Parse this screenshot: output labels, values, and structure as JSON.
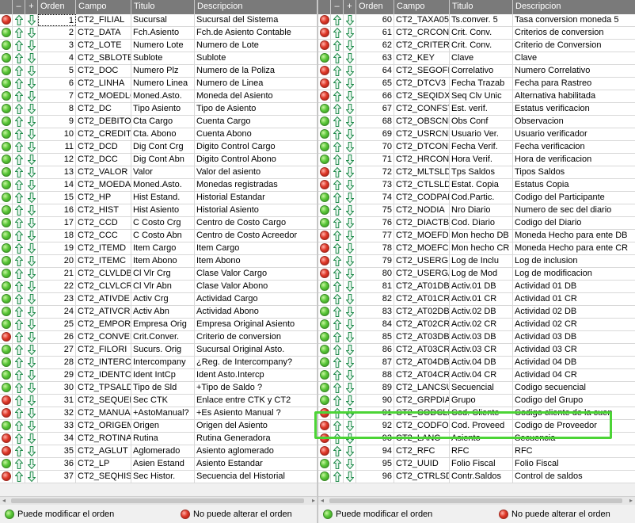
{
  "columns": {
    "dash": "–",
    "plus": "+",
    "orden": "Orden",
    "campo": "Campo",
    "titulo": "Titulo",
    "descripcion": "Descripcion"
  },
  "colors": {
    "header_bg": "#7a7a7a",
    "green": "#4cb82e",
    "red": "#d63322",
    "arrow": "#1f8a4a",
    "highlight": "#4cd436"
  },
  "legend": {
    "can_modify": "Puede modificar el orden",
    "cannot_modify": "No puede alterar el orden"
  },
  "left_rows": [
    {
      "status": "red",
      "orden": "1",
      "campo": "CT2_FILIAL",
      "titulo": "Sucursal",
      "descripcion": "Sucursal del Sistema"
    },
    {
      "status": "green",
      "orden": "2",
      "campo": "CT2_DATA",
      "titulo": "Fch.Asiento",
      "descripcion": "Fch.de Asiento Contable"
    },
    {
      "status": "green",
      "orden": "3",
      "campo": "CT2_LOTE",
      "titulo": "Numero Lote",
      "descripcion": "Numero de Lote"
    },
    {
      "status": "green",
      "orden": "4",
      "campo": "CT2_SBLOTE",
      "titulo": "Sublote",
      "descripcion": "Sublote"
    },
    {
      "status": "green",
      "orden": "5",
      "campo": "CT2_DOC",
      "titulo": "Numero Plz",
      "descripcion": "Numero de la Poliza"
    },
    {
      "status": "green",
      "orden": "6",
      "campo": "CT2_LINHA",
      "titulo": "Numero Linea",
      "descripcion": "Numero de Linea"
    },
    {
      "status": "green",
      "orden": "7",
      "campo": "CT2_MOEDLC",
      "titulo": "Moned.Asto.",
      "descripcion": "Moneda del Asiento"
    },
    {
      "status": "green",
      "orden": "8",
      "campo": "CT2_DC",
      "titulo": "Tipo Asiento",
      "descripcion": "Tipo de Asiento"
    },
    {
      "status": "green",
      "orden": "9",
      "campo": "CT2_DEBITO",
      "titulo": "Cta Cargo",
      "descripcion": "Cuenta Cargo"
    },
    {
      "status": "green",
      "orden": "10",
      "campo": "CT2_CREDIT",
      "titulo": "Cta. Abono",
      "descripcion": "Cuenta Abono"
    },
    {
      "status": "green",
      "orden": "11",
      "campo": "CT2_DCD",
      "titulo": "Dig Cont Crg",
      "descripcion": "Digito Control Cargo"
    },
    {
      "status": "green",
      "orden": "12",
      "campo": "CT2_DCC",
      "titulo": "Dig Cont Abn",
      "descripcion": "Digito Control Abono"
    },
    {
      "status": "green",
      "orden": "13",
      "campo": "CT2_VALOR",
      "titulo": "Valor",
      "descripcion": "Valor del asiento"
    },
    {
      "status": "green",
      "orden": "14",
      "campo": "CT2_MOEDAS",
      "titulo": "Moned.Asto.",
      "descripcion": "Monedas registradas"
    },
    {
      "status": "green",
      "orden": "15",
      "campo": "CT2_HP",
      "titulo": "Hist Estand.",
      "descripcion": "Historial Estandar"
    },
    {
      "status": "green",
      "orden": "16",
      "campo": "CT2_HIST",
      "titulo": "Hist Asiento",
      "descripcion": "Historial Asiento"
    },
    {
      "status": "green",
      "orden": "17",
      "campo": "CT2_CCD",
      "titulo": "C Costo Crg",
      "descripcion": "Centro de Costo Cargo"
    },
    {
      "status": "green",
      "orden": "18",
      "campo": "CT2_CCC",
      "titulo": "C Costo Abn",
      "descripcion": "Centro de Costo Acreedor"
    },
    {
      "status": "green",
      "orden": "19",
      "campo": "CT2_ITEMD",
      "titulo": "Item Cargo",
      "descripcion": "Item Cargo"
    },
    {
      "status": "green",
      "orden": "20",
      "campo": "CT2_ITEMC",
      "titulo": "Item Abono",
      "descripcion": "Item Abono"
    },
    {
      "status": "green",
      "orden": "21",
      "campo": "CT2_CLVLDB",
      "titulo": "Cl Vlr Crg",
      "descripcion": "Clase Valor Cargo"
    },
    {
      "status": "green",
      "orden": "22",
      "campo": "CT2_CLVLCR",
      "titulo": "Cl Vlr Abn",
      "descripcion": "Clase Valor Abono"
    },
    {
      "status": "green",
      "orden": "23",
      "campo": "CT2_ATIVDE",
      "titulo": "Activ Crg",
      "descripcion": "Actividad Cargo"
    },
    {
      "status": "green",
      "orden": "24",
      "campo": "CT2_ATIVCR",
      "titulo": "Activ Abn",
      "descripcion": "Actividad Abono"
    },
    {
      "status": "green",
      "orden": "25",
      "campo": "CT2_EMPORI",
      "titulo": "Empresa Orig",
      "descripcion": "Empresa Original Asiento"
    },
    {
      "status": "red",
      "orden": "26",
      "campo": "CT2_CONVER",
      "titulo": "Crit.Conver.",
      "descripcion": "Criterio de conversion"
    },
    {
      "status": "green",
      "orden": "27",
      "campo": "CT2_FILORI",
      "titulo": "Sucurs. Orig",
      "descripcion": "Sucursal Original Asto."
    },
    {
      "status": "green",
      "orden": "28",
      "campo": "CT2_INTERC",
      "titulo": "Intercompany",
      "descripcion": "¿Reg. de Intercompany?"
    },
    {
      "status": "green",
      "orden": "29",
      "campo": "CT2_IDENTC",
      "titulo": "Ident IntCp",
      "descripcion": "Ident Asto.Intercp"
    },
    {
      "status": "green",
      "orden": "30",
      "campo": "CT2_TPSALD",
      "titulo": "Tipo de Sld",
      "descripcion": "+Tipo de Saldo         ?"
    },
    {
      "status": "red",
      "orden": "31",
      "campo": "CT2_SEQUEN",
      "titulo": "Sec CTK",
      "descripcion": "Enlace entre CTK y CT2"
    },
    {
      "status": "red",
      "orden": "32",
      "campo": "CT2_MANUAL",
      "titulo": "+AstoManual?",
      "descripcion": "+Es Asiento Manual  ?"
    },
    {
      "status": "green",
      "orden": "33",
      "campo": "CT2_ORIGEM",
      "titulo": "Origen",
      "descripcion": "Origen del Asiento"
    },
    {
      "status": "red",
      "orden": "34",
      "campo": "CT2_ROTINA",
      "titulo": "Rutina",
      "descripcion": "Rutina Generadora"
    },
    {
      "status": "red",
      "orden": "35",
      "campo": "CT2_AGLUT",
      "titulo": "Aglomerado",
      "descripcion": "Asiento aglomerado"
    },
    {
      "status": "green",
      "orden": "36",
      "campo": "CT2_LP",
      "titulo": "Asien Estand",
      "descripcion": "Asiento Estandar"
    },
    {
      "status": "red",
      "orden": "37",
      "campo": "CT2_SEQHIS",
      "titulo": "Sec Histor.",
      "descripcion": "Secuencia del Historial"
    }
  ],
  "right_rows": [
    {
      "status": "red",
      "orden": "60",
      "campo": "CT2_TAXA05",
      "titulo": "Ts.conver. 5",
      "descripcion": "Tasa conversion moneda 5"
    },
    {
      "status": "red",
      "orden": "61",
      "campo": "CT2_CRCONV",
      "titulo": "Crit. Conv.",
      "descripcion": "Criterios de conversion"
    },
    {
      "status": "red",
      "orden": "62",
      "campo": "CT2_CRITER",
      "titulo": "Crit. Conv.",
      "descripcion": "Criterio de Conversion"
    },
    {
      "status": "green",
      "orden": "63",
      "campo": "CT2_KEY",
      "titulo": "Clave",
      "descripcion": "Clave"
    },
    {
      "status": "red",
      "orden": "64",
      "campo": "CT2_SEGOFI",
      "titulo": "Correlativo",
      "descripcion": "Numero Correlativo"
    },
    {
      "status": "red",
      "orden": "65",
      "campo": "CT2_DTCV3",
      "titulo": "Fecha Trazab",
      "descripcion": "Fecha para Rastreo"
    },
    {
      "status": "red",
      "orden": "66",
      "campo": "CT2_SEQIDX",
      "titulo": "Seq Clv Unic",
      "descripcion": "Alternativa habilitada"
    },
    {
      "status": "green",
      "orden": "67",
      "campo": "CT2_CONFST",
      "titulo": "Est. verif.",
      "descripcion": "Estatus verificacion"
    },
    {
      "status": "green",
      "orden": "68",
      "campo": "CT2_OBSCNF",
      "titulo": "Obs Conf",
      "descripcion": "Observacion"
    },
    {
      "status": "green",
      "orden": "69",
      "campo": "CT2_USRCNF",
      "titulo": "Usuario Ver.",
      "descripcion": "Usuario verificador"
    },
    {
      "status": "green",
      "orden": "70",
      "campo": "CT2_DTCONF",
      "titulo": "Fecha Verif.",
      "descripcion": "Fecha verificacion"
    },
    {
      "status": "green",
      "orden": "71",
      "campo": "CT2_HRCONF",
      "titulo": "Hora Verif.",
      "descripcion": "Hora de verificacion"
    },
    {
      "status": "red",
      "orden": "72",
      "campo": "CT2_MLTSLD",
      "titulo": "Tps Saldos",
      "descripcion": "Tipos Saldos"
    },
    {
      "status": "red",
      "orden": "73",
      "campo": "CT2_CTLSLD",
      "titulo": "Estat. Copia",
      "descripcion": "Estatus Copia"
    },
    {
      "status": "green",
      "orden": "74",
      "campo": "CT2_CODPAR",
      "titulo": "Cod.Partic.",
      "descripcion": "Codigo del Participante"
    },
    {
      "status": "green",
      "orden": "75",
      "campo": "CT2_NODIA",
      "titulo": "Nro Diario",
      "descripcion": "Numero de sec del diario"
    },
    {
      "status": "green",
      "orden": "76",
      "campo": "CT2_DIACTB",
      "titulo": "Cod. Diario",
      "descripcion": "Codigo del Diario"
    },
    {
      "status": "red",
      "orden": "77",
      "campo": "CT2_MOEFDB",
      "titulo": "Mon hecho DB",
      "descripcion": "Moneda Hecho para ente DB"
    },
    {
      "status": "red",
      "orden": "78",
      "campo": "CT2_MOEFCR",
      "titulo": "Mon hecho CR",
      "descripcion": "Moneda Hecho para ente CR"
    },
    {
      "status": "red",
      "orden": "79",
      "campo": "CT2_USERGI",
      "titulo": "Log de Inclu",
      "descripcion": "Log de inclusion"
    },
    {
      "status": "red",
      "orden": "80",
      "campo": "CT2_USERGA",
      "titulo": "Log de Mod",
      "descripcion": "Log de modificacion"
    },
    {
      "status": "green",
      "orden": "81",
      "campo": "CT2_AT01DB",
      "titulo": "Activ.01 DB",
      "descripcion": "Actividad 01 DB"
    },
    {
      "status": "green",
      "orden": "82",
      "campo": "CT2_AT01CR",
      "titulo": "Activ.01 CR",
      "descripcion": "Actividad 01 CR"
    },
    {
      "status": "green",
      "orden": "83",
      "campo": "CT2_AT02DB",
      "titulo": "Activ.02 DB",
      "descripcion": "Actividad 02 DB"
    },
    {
      "status": "green",
      "orden": "84",
      "campo": "CT2_AT02CR",
      "titulo": "Activ.02 CR",
      "descripcion": "Actividad 02 CR"
    },
    {
      "status": "green",
      "orden": "85",
      "campo": "CT2_AT03DB",
      "titulo": "Activ.03 DB",
      "descripcion": "Actividad 03 DB"
    },
    {
      "status": "green",
      "orden": "86",
      "campo": "CT2_AT03CR",
      "titulo": "Activ.03 CR",
      "descripcion": "Actividad 03 CR"
    },
    {
      "status": "green",
      "orden": "87",
      "campo": "CT2_AT04DB",
      "titulo": "Activ.04 DB",
      "descripcion": "Actividad 04 DB"
    },
    {
      "status": "green",
      "orden": "88",
      "campo": "CT2_AT04CR",
      "titulo": "Activ.04 CR",
      "descripcion": "Actividad 04 CR"
    },
    {
      "status": "green",
      "orden": "89",
      "campo": "CT2_LANCSU",
      "titulo": "Secuencial",
      "descripcion": "Codigo secuencial"
    },
    {
      "status": "green",
      "orden": "90",
      "campo": "CT2_GRPDIA",
      "titulo": "Grupo",
      "descripcion": "Codigo del Grupo"
    },
    {
      "status": "red",
      "orden": "91",
      "campo": "CT2_CODCLI",
      "titulo": "Cod. Cliente",
      "descripcion": "Codigo cliente de la cuen"
    },
    {
      "status": "red",
      "orden": "92",
      "campo": "CT2_CODFOR",
      "titulo": "Cod. Proveed",
      "descripcion": "Codigo de Proveedor"
    },
    {
      "status": "red",
      "orden": "93",
      "campo": "CT2_LANC",
      "titulo": "Asiento",
      "descripcion": "Secuencia"
    },
    {
      "status": "red",
      "orden": "94",
      "campo": "CT2_RFC",
      "titulo": "RFC",
      "descripcion": "RFC"
    },
    {
      "status": "green",
      "orden": "95",
      "campo": "CT2_UUID",
      "titulo": "Folio Fiscal",
      "descripcion": "Folio Fiscal"
    },
    {
      "status": "green",
      "orden": "96",
      "campo": "CT2_CTRLSD",
      "titulo": "Contr.Saldos",
      "descripcion": "Control de saldos"
    }
  ]
}
